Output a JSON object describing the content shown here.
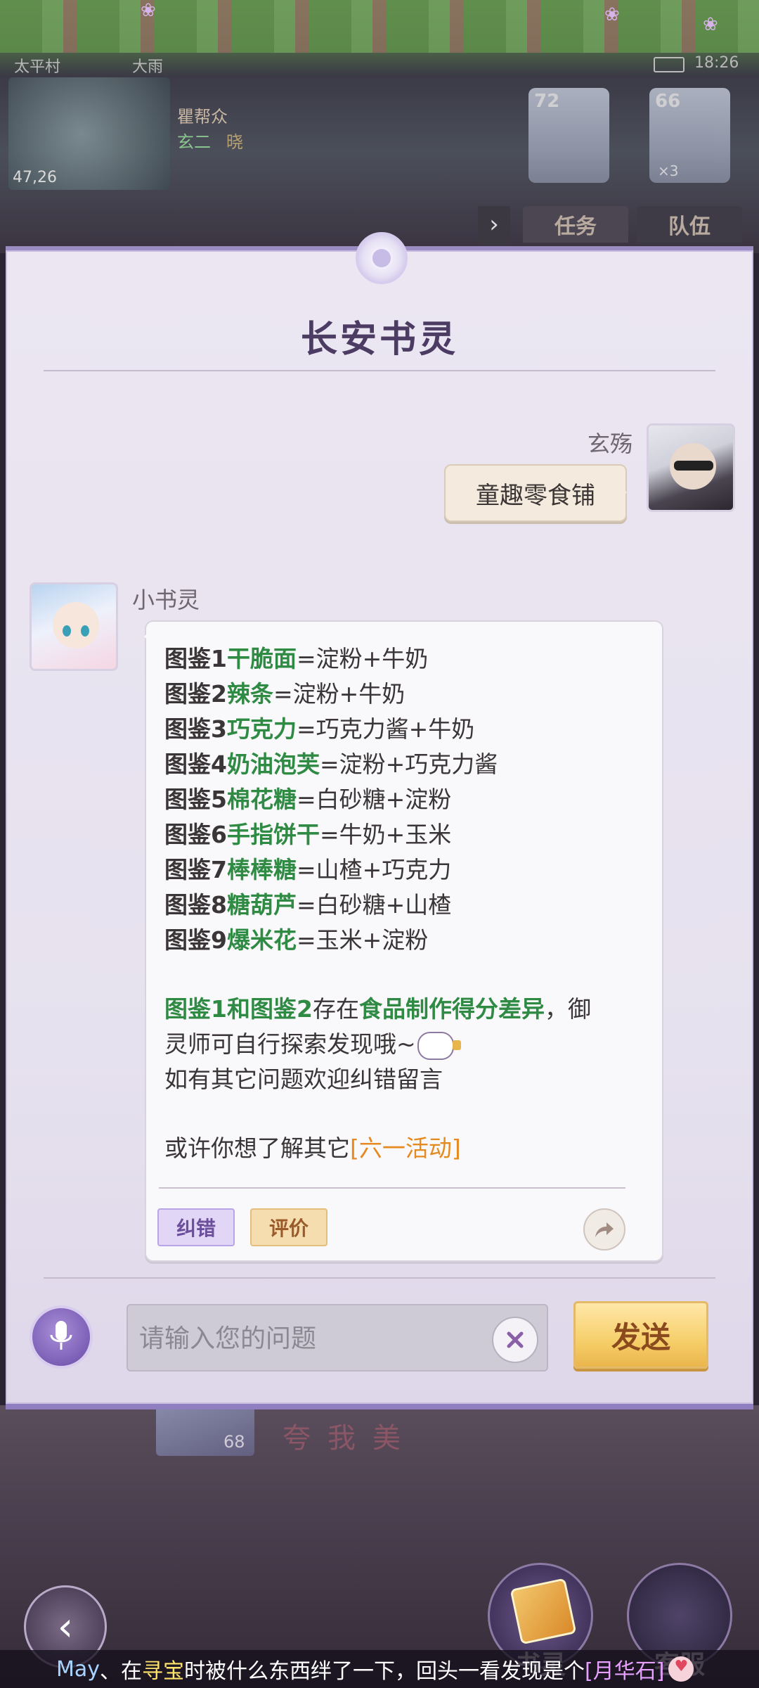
{
  "hud": {
    "location": "太平村",
    "weather": "大雨",
    "time": "18:26",
    "coords": "47,26",
    "guild_label": "瞿帮众",
    "player_tag": "玄二",
    "player_tag2": "晓",
    "portrait1_level": "72",
    "portrait2_level": "66",
    "portrait2_extra": "×3",
    "tabs": [
      "任务",
      "队伍"
    ]
  },
  "dialog": {
    "title": "长安书灵",
    "user": {
      "name": "玄殇",
      "message": "童趣零食铺"
    },
    "bot": {
      "name": "小书灵",
      "recipes": [
        {
          "prefix": "图鉴1",
          "item": "干脆面",
          "formula": "=淀粉+牛奶"
        },
        {
          "prefix": "图鉴2",
          "item": "辣条",
          "formula": "=淀粉+牛奶"
        },
        {
          "prefix": "图鉴3",
          "item": "巧克力",
          "formula": "=巧克力酱+牛奶"
        },
        {
          "prefix": "图鉴4",
          "item": "奶油泡芙",
          "formula": "=淀粉+巧克力酱"
        },
        {
          "prefix": "图鉴5",
          "item": "棉花糖",
          "formula": "=白砂糖+淀粉"
        },
        {
          "prefix": "图鉴6",
          "item": "手指饼干",
          "formula": "=牛奶+玉米"
        },
        {
          "prefix": "图鉴7",
          "item": "棒棒糖",
          "formula": "=山楂+巧克力"
        },
        {
          "prefix": "图鉴8",
          "item": "糖葫芦",
          "formula": "=白砂糖+山楂"
        },
        {
          "prefix": "图鉴9",
          "item": "爆米花",
          "formula": "=玉米+淀粉"
        }
      ],
      "note_highlight1": "图鉴1和图鉴2",
      "note_mid": "存在",
      "note_highlight2": "食品制作得分差异",
      "note_end": "，御",
      "note_line2": "灵师可自行探索发现哦~",
      "note_line3": "如有其它问题欢迎纠错留言",
      "suggest_prefix": "或许你想了解其它",
      "suggest_link": "[六一活动]",
      "correct_label": "纠错",
      "rate_label": "评价"
    },
    "input": {
      "placeholder": "请输入您的问题",
      "value": ""
    },
    "send_label": "发送"
  },
  "bottom": {
    "hero_level": "68",
    "banner_text": "夸我美",
    "menu_shuling": "书灵",
    "menu_kefu": "客服"
  },
  "ticker": {
    "user": "May",
    "sep": "、在",
    "place": "寻宝",
    "middle": "时被什么东西绊了一下，回头一看发现是个",
    "item": "[月华石]"
  },
  "colors": {
    "accent_purple": "#8f7fc0",
    "highlight_green": "#2f8a44",
    "link_orange": "#e58a1f",
    "send_gold": "#f6cf6a"
  }
}
